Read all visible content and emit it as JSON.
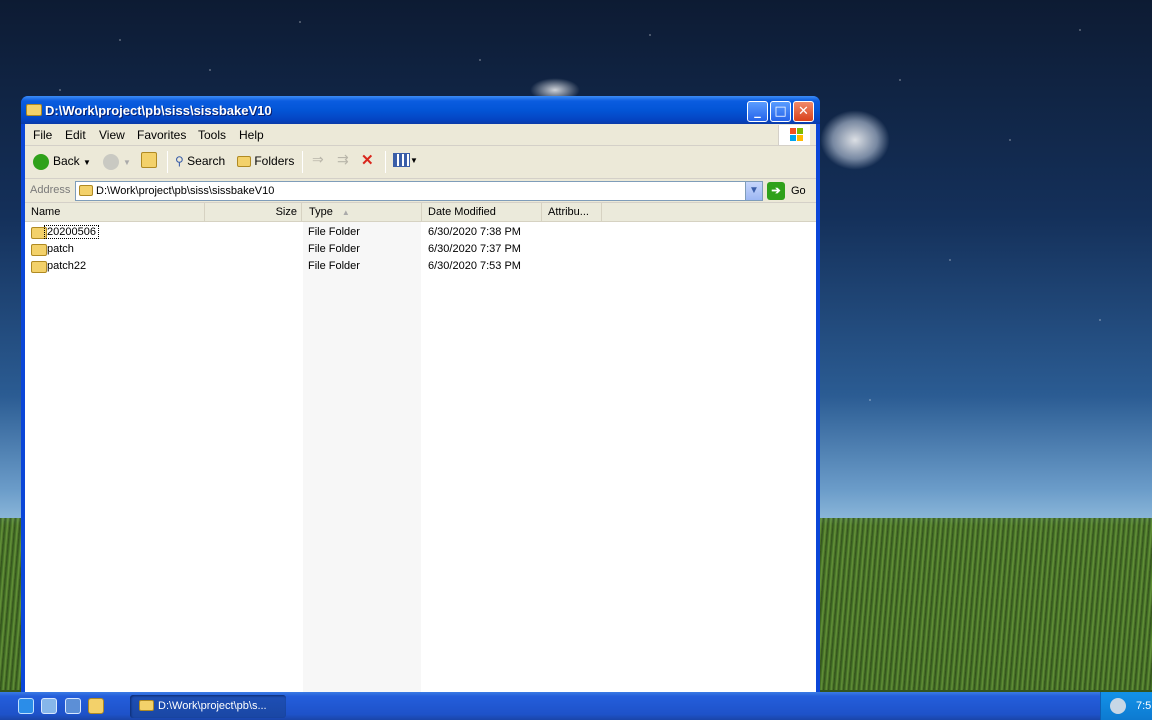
{
  "window": {
    "title": "D:\\Work\\project\\pb\\siss\\sissbakeV10",
    "controls": {
      "minimize": "_",
      "maximize": "□",
      "close": "✕"
    }
  },
  "menu": {
    "items": [
      "File",
      "Edit",
      "View",
      "Favorites",
      "Tools",
      "Help"
    ]
  },
  "toolbar": {
    "back_label": "Back",
    "search_label": "Search",
    "folders_label": "Folders"
  },
  "address": {
    "label": "Address",
    "value": "D:\\Work\\project\\pb\\siss\\sissbakeV10",
    "go_label": "Go"
  },
  "columns": {
    "name": "Name",
    "size": "Size",
    "type": "Type",
    "date_modified": "Date Modified",
    "attributes": "Attribu..."
  },
  "files": [
    {
      "name": "20200506",
      "type": "File Folder",
      "date": "6/30/2020 7:38 PM"
    },
    {
      "name": "patch",
      "type": "File Folder",
      "date": "6/30/2020 7:37 PM"
    },
    {
      "name": "patch22",
      "type": "File Folder",
      "date": "6/30/2020 7:53 PM"
    }
  ],
  "taskbar": {
    "task_label": "D:\\Work\\project\\pb\\s...",
    "clock": "7:5"
  },
  "colors": {
    "titlebar": "#0355d6",
    "taskbar": "#245edb",
    "tray": "#1392e9",
    "window_bg": "#ece9d8"
  },
  "icons": [
    "folder-icon",
    "back-arrow-icon",
    "forward-arrow-icon",
    "up-folder-icon",
    "search-icon",
    "folders-icon",
    "move-to-icon",
    "copy-to-icon",
    "delete-icon",
    "views-icon",
    "go-arrow-icon",
    "windows-flag-icon"
  ]
}
